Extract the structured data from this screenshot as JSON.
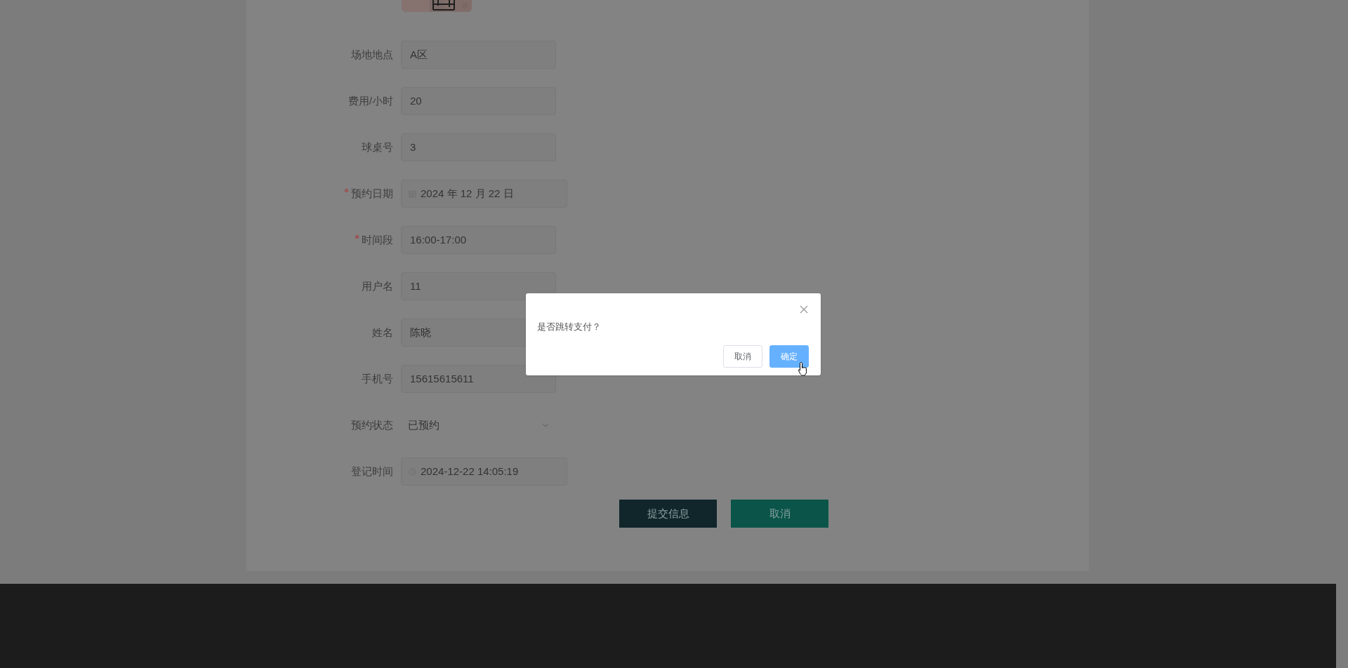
{
  "form": {
    "fields": [
      {
        "label": "场地地点",
        "value": "A区",
        "kind": "text",
        "required": false
      },
      {
        "label": "费用/小时",
        "value": "20",
        "kind": "text",
        "required": false
      },
      {
        "label": "球桌号",
        "value": "3",
        "kind": "text",
        "required": false
      },
      {
        "label": "预约日期",
        "value": "2024 年 12 月 22 日",
        "kind": "date",
        "required": true
      },
      {
        "label": "时间段",
        "value": "16:00-17:00",
        "kind": "text",
        "required": true
      },
      {
        "label": "用户名",
        "value": "11",
        "kind": "text",
        "required": false
      },
      {
        "label": "姓名",
        "value": "陈晓",
        "kind": "text",
        "required": false
      },
      {
        "label": "手机号",
        "value": "15615615611",
        "kind": "text",
        "required": false
      },
      {
        "label": "预约状态",
        "value": "已预约",
        "kind": "select",
        "required": false
      },
      {
        "label": "登记时间",
        "value": "2024-12-22 14:05:19",
        "kind": "datetime",
        "required": false
      }
    ],
    "buttons": [
      {
        "label": "提交信息",
        "kind": "submit"
      },
      {
        "label": "取消",
        "kind": "cancel"
      }
    ]
  },
  "dialog": {
    "message": "是否跳转支付？",
    "buttons": [
      {
        "label": "取消",
        "kind": "default"
      },
      {
        "label": "确定",
        "kind": "primary"
      }
    ]
  }
}
